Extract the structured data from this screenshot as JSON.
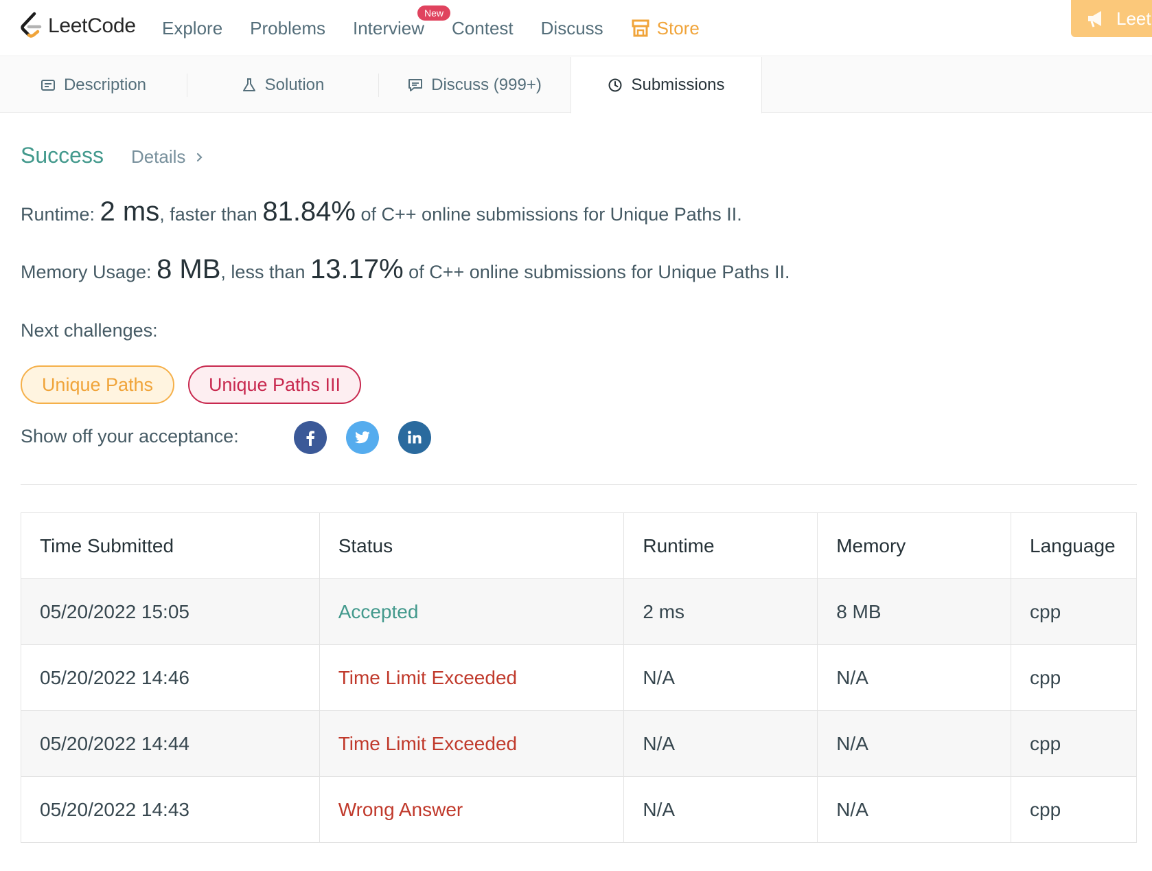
{
  "navbar": {
    "brand": "LeetCode",
    "links": [
      "Explore",
      "Problems",
      "Interview",
      "Contest",
      "Discuss"
    ],
    "new_badge": "New",
    "store": "Store",
    "premium": "Leet"
  },
  "tabs": {
    "description": "Description",
    "solution": "Solution",
    "discuss": "Discuss (999+)",
    "submissions": "Submissions",
    "active": "Submissions"
  },
  "result": {
    "status": "Success",
    "details": "Details",
    "runtime_label": "Runtime: ",
    "runtime_value": "2 ms",
    "runtime_mid": ", faster than ",
    "runtime_pct": "81.84%",
    "runtime_tail": " of C++ online submissions for Unique Paths II.",
    "memory_label": "Memory Usage: ",
    "memory_value": "8 MB",
    "memory_mid": ", less than ",
    "memory_pct": "13.17%",
    "memory_tail": " of C++ online submissions for Unique Paths II."
  },
  "next": {
    "label": "Next challenges:",
    "challenges": [
      "Unique Paths",
      "Unique Paths III"
    ]
  },
  "share": {
    "label": "Show off your acceptance:",
    "networks": [
      "facebook-icon",
      "twitter-icon",
      "linkedin-icon"
    ]
  },
  "table": {
    "headers": [
      "Time Submitted",
      "Status",
      "Runtime",
      "Memory",
      "Language"
    ],
    "rows": [
      {
        "time": "05/20/2022 15:05",
        "status": "Accepted",
        "runtime": "2 ms",
        "memory": "8 MB",
        "language": "cpp"
      },
      {
        "time": "05/20/2022 14:46",
        "status": "Time Limit Exceeded",
        "runtime": "N/A",
        "memory": "N/A",
        "language": "cpp"
      },
      {
        "time": "05/20/2022 14:44",
        "status": "Time Limit Exceeded",
        "runtime": "N/A",
        "memory": "N/A",
        "language": "cpp"
      },
      {
        "time": "05/20/2022 14:43",
        "status": "Wrong Answer",
        "runtime": "N/A",
        "memory": "N/A",
        "language": "cpp"
      }
    ]
  },
  "colors": {
    "accent_green": "#42998c",
    "error_red": "#c0392b",
    "store_orange": "#f0a43a",
    "badge_pink": "#e0435e"
  }
}
